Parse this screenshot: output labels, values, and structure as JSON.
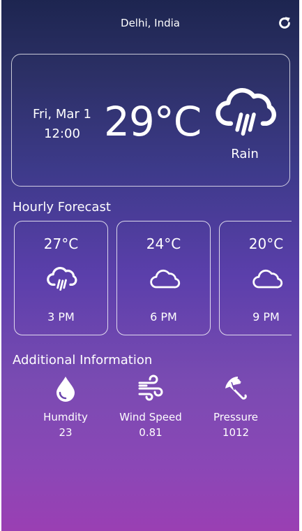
{
  "header": {
    "location": "Delhi, India",
    "refresh_icon": "refresh-icon"
  },
  "current": {
    "date": "Fri, Mar 1",
    "time": "12:00",
    "temperature": "29°C",
    "condition": "Rain",
    "icon": "cloud-rain-icon"
  },
  "hourly": {
    "title": "Hourly Forecast",
    "items": [
      {
        "temp": "27°C",
        "time": "3 PM",
        "icon": "cloud-rain-icon"
      },
      {
        "temp": "24°C",
        "time": "6 PM",
        "icon": "cloud-icon"
      },
      {
        "temp": "20°C",
        "time": "9 PM",
        "icon": "cloud-icon"
      }
    ]
  },
  "additional": {
    "title": "Additional Information",
    "items": [
      {
        "label": "Humdity",
        "value": "23",
        "icon": "water-drop-icon"
      },
      {
        "label": "Wind Speed",
        "value": "0.81",
        "icon": "wind-icon"
      },
      {
        "label": "Pressure",
        "value": "1012",
        "icon": "umbrella-icon"
      }
    ]
  },
  "colors": {
    "gradient_top": "#1d2550",
    "gradient_bottom": "#9a3fb3",
    "text": "#ffffff"
  }
}
